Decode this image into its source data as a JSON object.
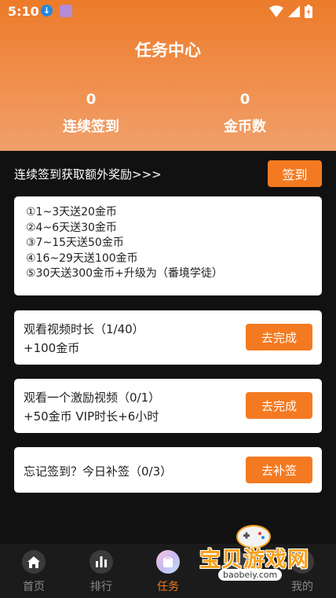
{
  "status_bar": {
    "time": "5:10"
  },
  "header": {
    "title": "任务中心",
    "stats": [
      {
        "value": "0",
        "label": "连续签到"
      },
      {
        "value": "0",
        "label": "金币数"
      }
    ]
  },
  "signin": {
    "prompt": "连续签到获取额外奖励>>>",
    "button_label": "签到"
  },
  "rules": [
    "①1~3天送20金币",
    "②4~6天送30金币",
    "③7~15天送50金币",
    "④16~29天送100金币",
    "⑤30天送300金币+升级为（番境学徒）"
  ],
  "tasks": [
    {
      "title": "观看视频时长（1/40）",
      "reward": "+100金币",
      "button": "去完成"
    },
    {
      "title": "观看一个激励视频（0/1）",
      "reward": "+50金币  VIP时长+6小时",
      "button": "去完成"
    },
    {
      "title": "忘记签到？今日补签（0/3）",
      "button": "去补签"
    }
  ],
  "bottom_nav": {
    "items": [
      {
        "label": "首页",
        "icon": "home-icon"
      },
      {
        "label": "排行",
        "icon": "ranking-icon"
      },
      {
        "label": "任务",
        "icon": "task-icon",
        "active": true
      },
      {
        "label": "",
        "icon": "unknown-icon"
      },
      {
        "label": "我的",
        "icon": "profile-icon"
      }
    ]
  },
  "watermark": {
    "text": "宝贝游戏网",
    "url": "baobeiy.com"
  },
  "colors": {
    "accent": "#f47a21",
    "header_top": "#ec7b2a",
    "background": "#111111"
  }
}
